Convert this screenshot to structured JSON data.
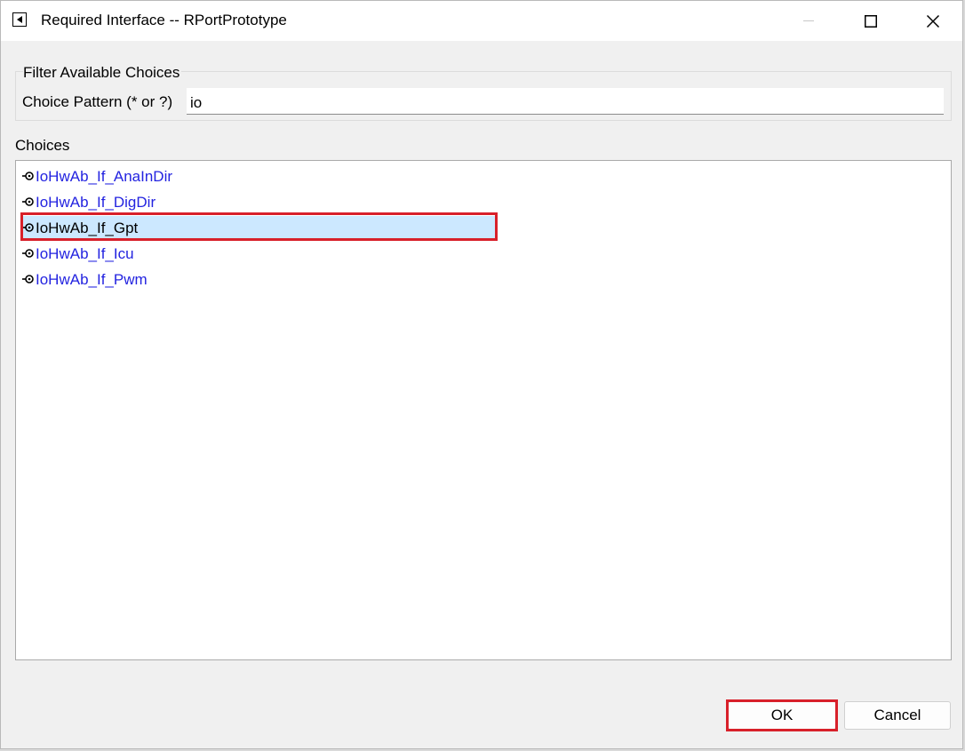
{
  "window": {
    "title": "Required Interface -- RPortPrototype"
  },
  "filter": {
    "group_title": "Filter Available Choices",
    "pattern_label": "Choice Pattern (* or ?)",
    "pattern_value": "io"
  },
  "choices": {
    "label": "Choices",
    "items": [
      {
        "label": "IoHwAb_If_AnaInDir",
        "icon": "required-port-icon",
        "selected": false
      },
      {
        "label": "IoHwAb_If_DigDir",
        "icon": "required-port-icon",
        "selected": false
      },
      {
        "label": "IoHwAb_If_Gpt",
        "icon": "required-port-icon",
        "selected": true
      },
      {
        "label": "IoHwAb_If_Icu",
        "icon": "required-port-icon",
        "selected": false
      },
      {
        "label": "IoHwAb_If_Pwm",
        "icon": "required-port-icon",
        "selected": false
      }
    ]
  },
  "buttons": {
    "ok": "OK",
    "cancel": "Cancel"
  },
  "colors": {
    "link_text": "#2323e0",
    "selection": "#cce8ff",
    "annotation_red": "#d8202a"
  }
}
